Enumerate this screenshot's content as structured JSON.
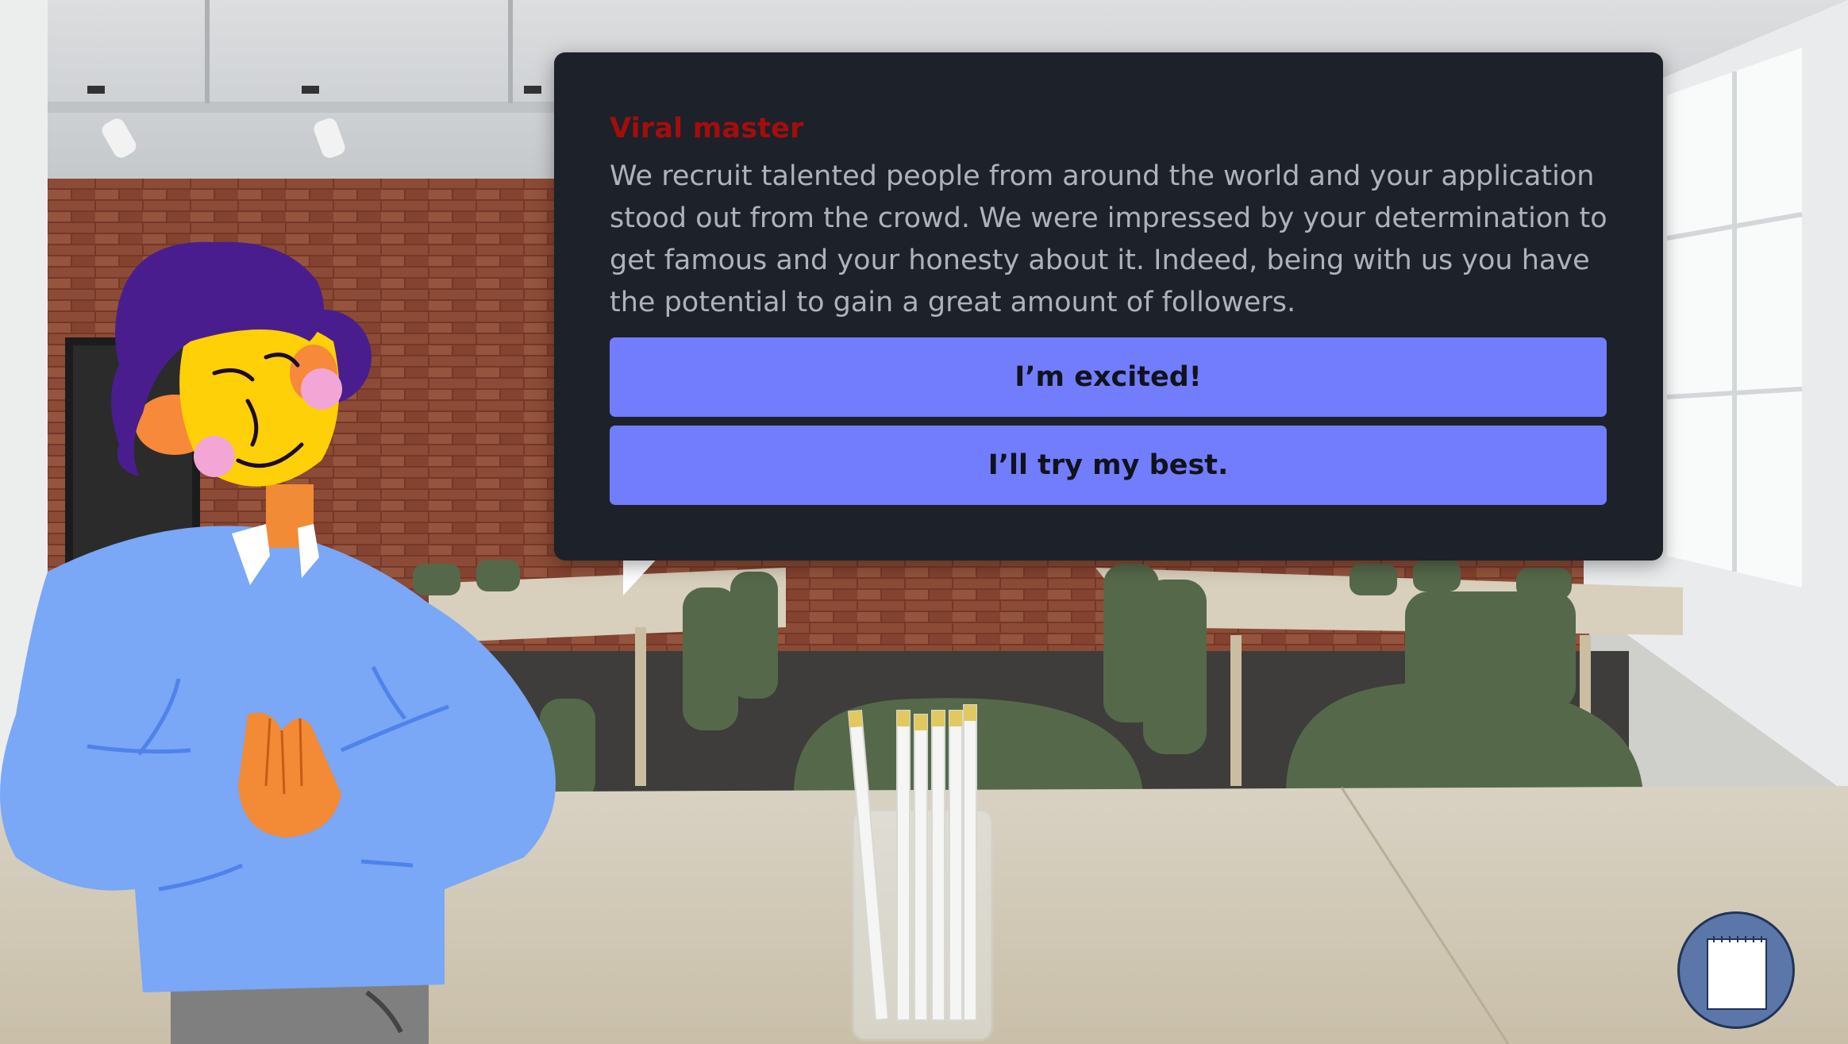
{
  "dialog": {
    "speaker": "Viral master",
    "message": "We recruit talented people from around the world and your application stood out from the crowd. We were impressed by your determination to get famous and your honesty about it. Indeed, being with us you have the potential to gain a great amount of followers.",
    "choices": [
      {
        "label": "I’m excited!"
      },
      {
        "label": "I’ll try my best."
      }
    ]
  },
  "colors": {
    "dialog_bg": "#1d2129",
    "speaker": "#a40d0d",
    "choice_bg": "#727dfd",
    "notebook_button": "#5b76a8"
  },
  "icons": {
    "notebook_button": "notebook-icon"
  }
}
